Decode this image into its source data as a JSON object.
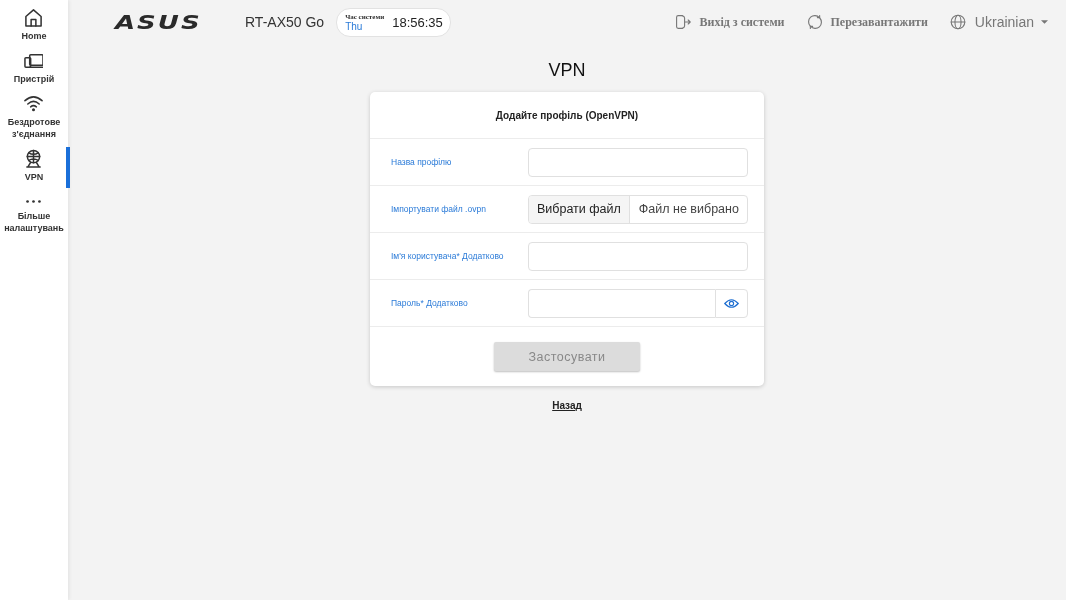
{
  "sidebar": {
    "items": [
      {
        "label": "Home",
        "selected": false
      },
      {
        "label": "Пристрій",
        "selected": false
      },
      {
        "label": "Бездротове з'єднання",
        "selected": false
      },
      {
        "label": "VPN",
        "selected": true
      },
      {
        "label": "Більше налаштувань",
        "selected": false
      }
    ]
  },
  "header": {
    "logo": "ASUS",
    "model": "RT-AX50 Go",
    "system_time": {
      "label": "Час системи",
      "day": "Thu",
      "time": "18:56:35"
    },
    "actions": [
      {
        "label": "Вихід з системи"
      },
      {
        "label": "Перезавантажити"
      }
    ],
    "language": {
      "label": "Ukrainian"
    }
  },
  "page_title": "VPN",
  "form": {
    "title": "Додайте профіль (OpenVPN)",
    "fields": [
      {
        "kind": "text",
        "label": "Назва профілю"
      },
      {
        "kind": "file",
        "label": "Імпортувати файл .ovpn",
        "button": "Вибрати файл",
        "status": "Файл не вибрано"
      },
      {
        "kind": "text",
        "label": "Ім'я користувача* Додатково"
      },
      {
        "kind": "password",
        "label": "Пароль* Додатково"
      }
    ],
    "submit": {
      "label": "Застосувати",
      "disabled": true
    }
  },
  "back_link": "Назад"
}
